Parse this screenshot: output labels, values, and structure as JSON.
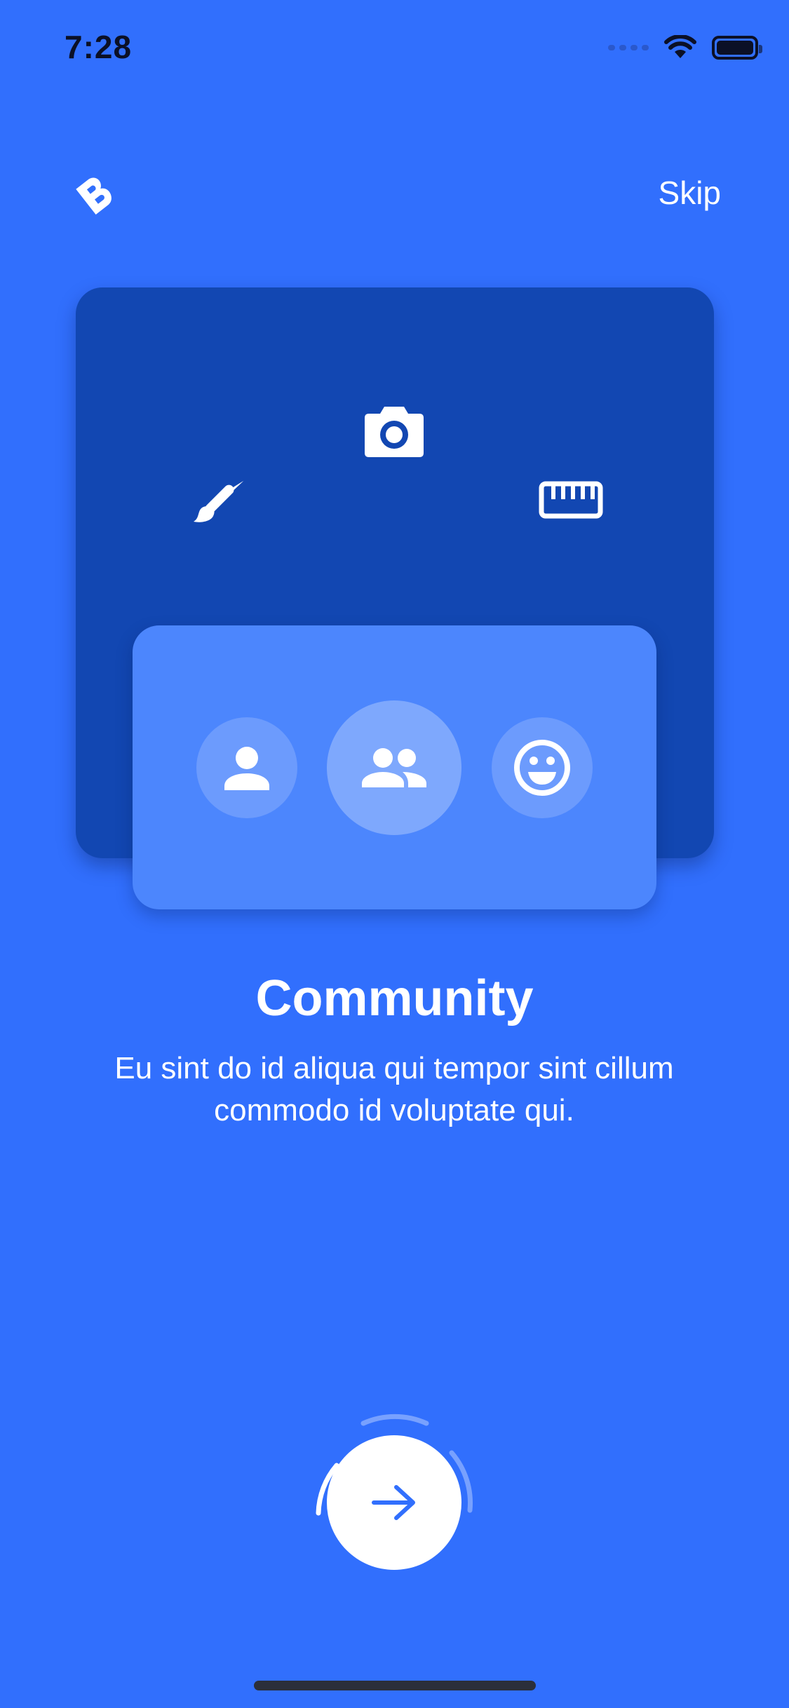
{
  "status_bar": {
    "time": "7:28"
  },
  "header": {
    "skip_label": "Skip",
    "logo_icon": "b-logo-icon"
  },
  "illustration": {
    "top_icons": [
      "paintbrush-icon",
      "camera-icon",
      "ruler-icon"
    ],
    "bottom_icons": [
      "person-icon",
      "people-icon",
      "smiley-icon"
    ]
  },
  "content": {
    "title": "Community",
    "subtitle": "Eu sint do id aliqua qui tempor sint cillum commodo id voluptate qui."
  },
  "next_button": {
    "icon": "arrow-right-icon"
  },
  "colors": {
    "background": "#316ffd",
    "card_back": "#1247b2",
    "card_front": "#4c86fd",
    "text": "#ffffff",
    "accent": "#316ffd"
  }
}
